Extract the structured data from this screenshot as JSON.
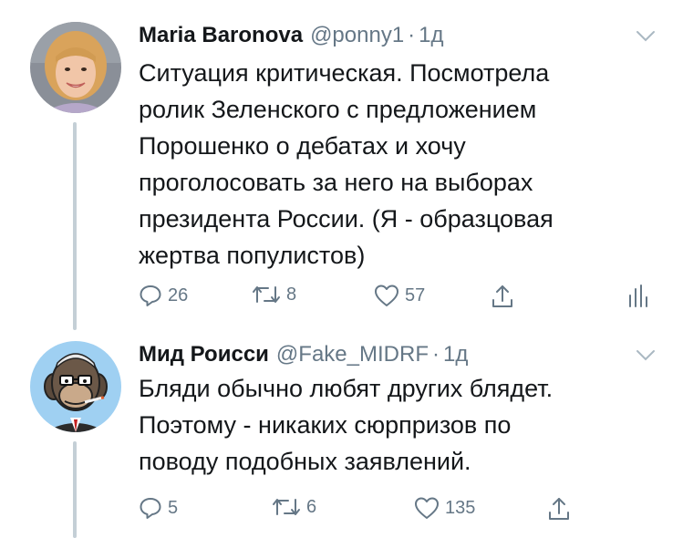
{
  "tweets": [
    {
      "author_name": "Maria Baronova",
      "handle": "@ponny1",
      "separator": "·",
      "time": "1д",
      "lines": [
        "Ситуация критическая. Посмотрела",
        "ролик Зеленского с предложением",
        "Порошенко о дебатах и хочу",
        "проголосовать за него на выборах",
        "президента России. (Я - образцовая",
        "жертва популистов)"
      ],
      "reply_count": "26",
      "retweet_count": "8",
      "like_count": "57"
    },
    {
      "author_name": "Мид Роисси",
      "handle": "@Fake_MIDRF",
      "separator": "·",
      "time": "1д",
      "lines": [
        "Бляди обычно любят других блядет.",
        "Поэтому - никаких сюрпризов по",
        "поводу подобных заявлений."
      ],
      "reply_count": "5",
      "retweet_count": "6",
      "like_count": "135"
    }
  ],
  "icons": {
    "reply": "reply-icon",
    "retweet": "retweet-icon",
    "like": "heart-icon",
    "share": "share-icon",
    "analytics": "analytics-icon",
    "caret": "chevron-down-icon"
  },
  "colors": {
    "text": "#14171a",
    "muted": "#657786",
    "thread_line": "#c4cfd6"
  }
}
